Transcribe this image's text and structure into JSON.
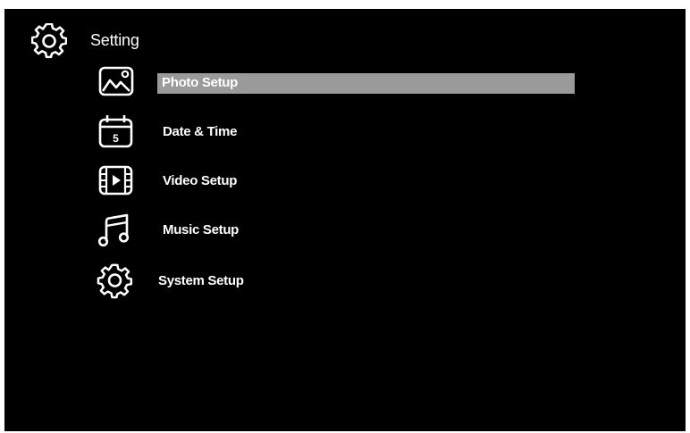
{
  "header": {
    "title": "Setting",
    "icon": "gear-icon"
  },
  "menu": {
    "items": [
      {
        "label": "Photo Setup",
        "icon": "photo-icon",
        "selected": true
      },
      {
        "label": "Date & Time",
        "icon": "calendar-icon",
        "icon_text": "5",
        "selected": false
      },
      {
        "label": "Video Setup",
        "icon": "film-icon",
        "selected": false
      },
      {
        "label": "Music Setup",
        "icon": "music-note-icon",
        "selected": false
      },
      {
        "label": "System Setup",
        "icon": "gear-icon",
        "selected": false
      }
    ]
  },
  "colors": {
    "background": "#000000",
    "text": "#ffffff",
    "selection": "#9a9a9a"
  }
}
